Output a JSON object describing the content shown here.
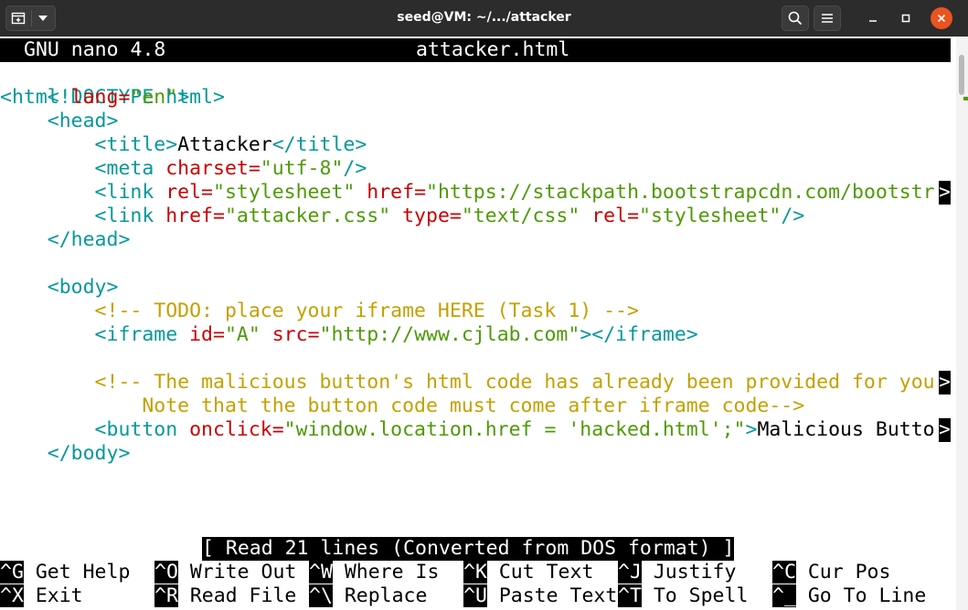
{
  "window": {
    "title": "seed@VM: ~/.../attacker"
  },
  "nano": {
    "app": "GNU nano 4.8",
    "filename": "attacker.html",
    "status": "[ Read 21 lines (Converted from DOS format) ]"
  },
  "code": {
    "l1": "<!DOCTYPE html>",
    "l2_open": "<html ",
    "l2_attr": "lang=",
    "l2_val": "\"en\"",
    "l2_close": ">",
    "l3": "    <head>",
    "l4_open": "        <title>",
    "l4_text": "Attacker",
    "l4_close": "</title>",
    "l5_open": "        <meta ",
    "l5_attr": "charset=",
    "l5_val": "\"utf-8\"",
    "l5_close": "/>",
    "l6_open": "        <link ",
    "l6_attr1": "rel=",
    "l6_val1": "\"stylesheet\"",
    "l6_attr2": " href=",
    "l6_val2": "\"https://stackpath.bootstrapcdn.com/bootstr",
    "l7_open": "        <link ",
    "l7_attr1": "href=",
    "l7_val1": "\"attacker.css\"",
    "l7_attr2": " type=",
    "l7_val2": "\"text/css\"",
    "l7_attr3": " rel=",
    "l7_val3": "\"stylesheet\"",
    "l7_close": "/>",
    "l8": "    </head>",
    "l10": "    <body>",
    "l11": "        <!-- TODO: place your iframe HERE (Task 1) -->",
    "l12_open": "        <iframe ",
    "l12_attr1": "id=",
    "l12_val1": "\"A\"",
    "l12_attr2": " src=",
    "l12_val2": "\"http://www.cjlab.com\"",
    "l12_close": "></iframe>",
    "l14": "        <!-- The malicious button's html code has already been provided for you",
    "l15": "            Note that the button code must come after iframe code-->",
    "l16_open": "        <button ",
    "l16_attr": "onclick=",
    "l16_val": "\"window.location.href = 'hacked.html';\"",
    "l16_close": ">",
    "l16_text": "Malicious Butto",
    "l17": "    </body>",
    "trunc_marker": ">"
  },
  "shortcuts": [
    {
      "key": "^G",
      "label": " Get Help"
    },
    {
      "key": "^O",
      "label": " Write Out"
    },
    {
      "key": "^W",
      "label": " Where Is"
    },
    {
      "key": "^K",
      "label": " Cut Text"
    },
    {
      "key": "^J",
      "label": " Justify"
    },
    {
      "key": "^C",
      "label": " Cur Pos"
    },
    {
      "key": "^X",
      "label": " Exit"
    },
    {
      "key": "^R",
      "label": " Read File"
    },
    {
      "key": "^\\",
      "label": " Replace"
    },
    {
      "key": "^U",
      "label": " Paste Text"
    },
    {
      "key": "^T",
      "label": " To Spell"
    },
    {
      "key": "^_",
      "label": " Go To Line"
    }
  ],
  "colors": {
    "tag": "#06989a",
    "attr": "#cc0000",
    "string": "#4e9a06",
    "comment": "#c4a000",
    "titlebar": "#2c2c2c",
    "close": "#e95420"
  },
  "icons": {
    "new_tab": "new-tab-icon",
    "dropdown": "chevron-down-icon",
    "search": "search-icon",
    "menu": "hamburger-icon",
    "minimize": "minimize-icon",
    "maximize": "maximize-icon",
    "close": "close-icon"
  }
}
